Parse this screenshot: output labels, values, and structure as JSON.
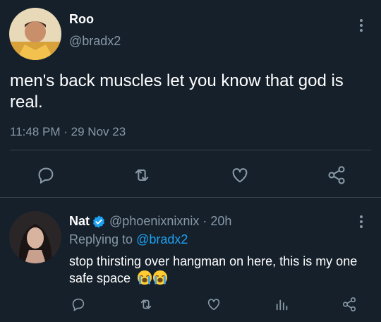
{
  "tweet": {
    "author_name": "Roo",
    "author_handle": "@bradx2",
    "text": "men's back muscles let you know that god is real.",
    "time": "11:48 PM",
    "separator": "·",
    "date": "29 Nov 23",
    "actions": [
      "reply-icon",
      "retweet-icon",
      "like-icon",
      "share-icon"
    ]
  },
  "reply": {
    "author_name": "Nat",
    "verified_icon": "verified-badge-icon",
    "author_handle": "@phoenixnixnix",
    "separator": "·",
    "age": "20h",
    "replying_to_label": "Replying to",
    "replying_to_handle": "@bradx2",
    "text": "stop thirsting over hangman on here, this is my one safe space",
    "emoji": [
      "loudly-crying-face",
      "loudly-crying-face"
    ],
    "actions": [
      "reply-icon",
      "retweet-icon",
      "like-icon",
      "analytics-icon",
      "share-icon"
    ]
  },
  "colors": {
    "background": "#15202b",
    "text": "#ffffff",
    "muted": "#8899a6",
    "accent": "#1da1f2",
    "divider": "#38444d"
  }
}
